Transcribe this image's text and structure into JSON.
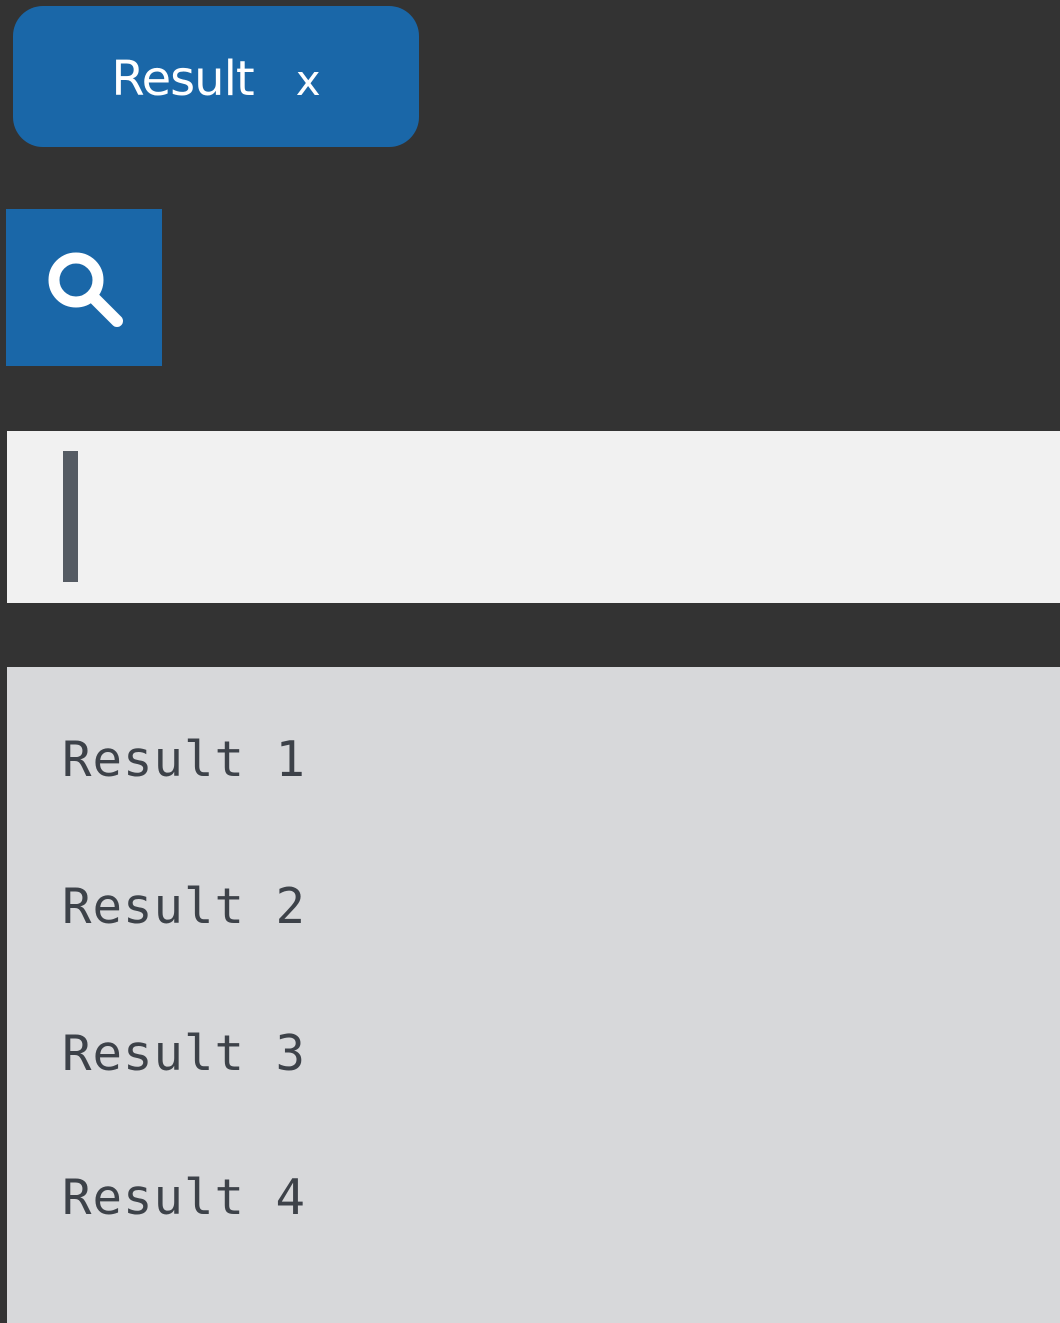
{
  "tag": {
    "label": "Result",
    "close_label": "x"
  },
  "search_button": {
    "icon": "search-icon"
  },
  "search_input": {
    "value": "",
    "placeholder": ""
  },
  "results": [
    {
      "label": "Result 1"
    },
    {
      "label": "Result 2"
    },
    {
      "label": "Result 3"
    },
    {
      "label": "Result 4"
    }
  ],
  "colors": {
    "background": "#333333",
    "accent": "#1a67a8",
    "input_background": "#f1f1f1",
    "list_background": "#d7d8da",
    "list_text": "#3d4249",
    "caret": "#555b63"
  }
}
